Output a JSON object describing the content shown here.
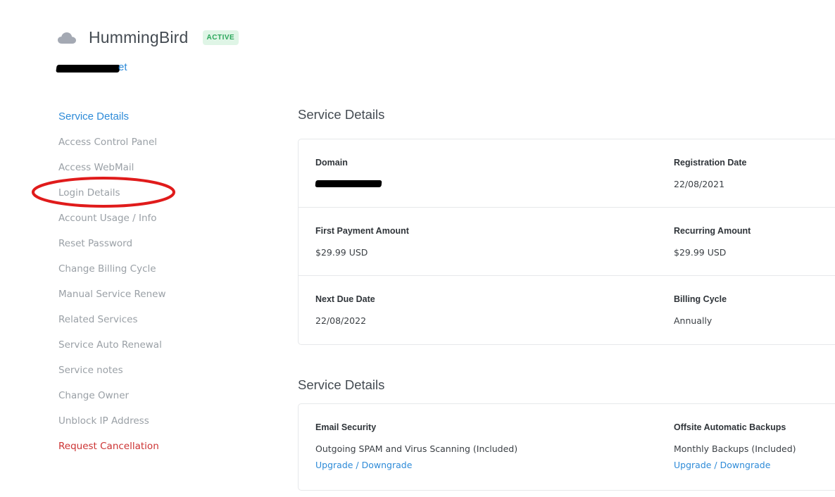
{
  "header": {
    "product_name": "HummingBird",
    "status": "ACTIVE",
    "link_tail": "et"
  },
  "sidebar": {
    "items": [
      {
        "label": "Service Details",
        "state": "active"
      },
      {
        "label": "Access Control Panel"
      },
      {
        "label": "Access WebMail"
      },
      {
        "label": "Login Details"
      },
      {
        "label": "Account Usage / Info"
      },
      {
        "label": "Reset Password"
      },
      {
        "label": "Change Billing Cycle"
      },
      {
        "label": "Manual Service Renew"
      },
      {
        "label": "Related Services"
      },
      {
        "label": "Service Auto Renewal"
      },
      {
        "label": "Service notes"
      },
      {
        "label": "Change Owner"
      },
      {
        "label": "Unblock IP Address"
      },
      {
        "label": "Request Cancellation",
        "state": "danger"
      }
    ]
  },
  "details": {
    "title": "Service Details",
    "domain_label": "Domain",
    "registration_label": "Registration Date",
    "registration_value": "22/08/2021",
    "first_payment_label": "First Payment Amount",
    "first_payment_value": "$29.99 USD",
    "recurring_label": "Recurring Amount",
    "recurring_value": "$29.99 USD",
    "next_due_label": "Next Due Date",
    "next_due_value": "22/08/2022",
    "billing_cycle_label": "Billing Cycle",
    "billing_cycle_value": "Annually"
  },
  "addons": {
    "title": "Service Details",
    "email_security_label": "Email Security",
    "email_security_value": "Outgoing SPAM and Virus Scanning (Included)",
    "email_security_link": "Upgrade / Downgrade",
    "backups_label": "Offsite Automatic Backups",
    "backups_value": "Monthly Backups (Included)",
    "backups_link": "Upgrade / Downgrade"
  },
  "colors": {
    "accent": "#2e8bd8",
    "danger": "#cc3333",
    "badge_bg": "#dff5e6",
    "badge_text": "#2aa65a",
    "annotation": "#e01b1b"
  },
  "icons": {
    "product": "cloud-icon"
  }
}
